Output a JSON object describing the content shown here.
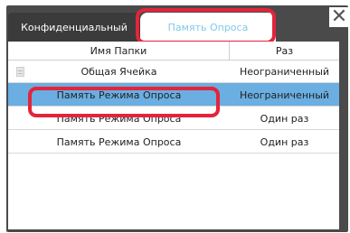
{
  "tabs": {
    "confidential_label": "Конфиденциальный",
    "polling_memory_label": "Память Опроса"
  },
  "table": {
    "headers": {
      "folder_name": "Имя Папки",
      "times": "Раз"
    },
    "rows": [
      {
        "name": "Общая Ячейка",
        "times": "Неограниченный",
        "icon": "document-icon"
      },
      {
        "name": "Память Режима Опроса",
        "times": "Неограниченный"
      },
      {
        "name": "Память Режима Опроса",
        "times": "Один раз"
      },
      {
        "name": "Память Режима Опроса",
        "times": "Один раз"
      }
    ],
    "selected_row_color": "#6aaee2"
  },
  "colors": {
    "highlight": "#e3243b",
    "panel_bg": "#4a4a4a",
    "active_tab_text": "#7ecbe8"
  },
  "close": {
    "label": "✕",
    "icon": "close-icon"
  }
}
